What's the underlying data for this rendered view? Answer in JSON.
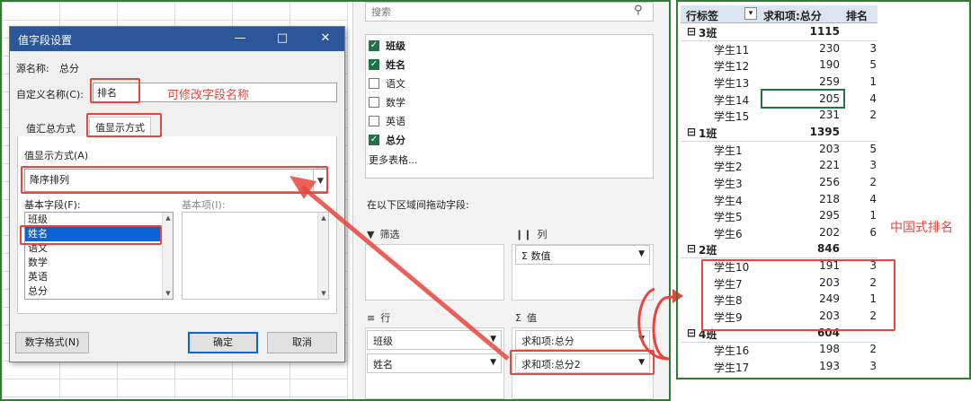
{
  "dialog": {
    "title": "值字段设置",
    "source_label": "源名称:",
    "source_value": "总分",
    "custom_label": "自定义名称(C):",
    "custom_value": "排名",
    "tabs": [
      "值汇总方式",
      "值显示方式"
    ],
    "display_label": "值显示方式(A)",
    "display_value": "降序排列",
    "base_field_label": "基本字段(F):",
    "base_item_label": "基本项(I):",
    "base_fields": [
      "班级",
      "姓名",
      "语文",
      "数学",
      "英语",
      "总分"
    ],
    "number_format_btn": "数字格式(N)",
    "ok_btn": "确定",
    "cancel_btn": "取消"
  },
  "annotations": {
    "edit_name": "可修改字段名称",
    "chinese_rank": "中国式排名"
  },
  "pane": {
    "search_placeholder": "搜索",
    "fields": [
      {
        "name": "班级",
        "checked": true
      },
      {
        "name": "姓名",
        "checked": true
      },
      {
        "name": "语文",
        "checked": false
      },
      {
        "name": "数学",
        "checked": false
      },
      {
        "name": "英语",
        "checked": false
      },
      {
        "name": "总分",
        "checked": true
      }
    ],
    "more_tables": "更多表格...",
    "drag_hint": "在以下区域间拖动字段:",
    "filter_label": "筛选",
    "columns_label": "列",
    "columns_chip": "数值",
    "rows_label": "行",
    "values_label": "值",
    "rows_chips": [
      "班级",
      "姓名"
    ],
    "values_chips": [
      "求和项:总分",
      "求和项:总分2"
    ]
  },
  "pivot": {
    "headers": [
      "行标签",
      "求和项:总分",
      "排名"
    ],
    "groups": [
      {
        "name": "3班",
        "total": "1115",
        "rows": [
          [
            "学生11",
            "230",
            "3"
          ],
          [
            "学生12",
            "190",
            "5"
          ],
          [
            "学生13",
            "259",
            "1"
          ],
          [
            "学生14",
            "205",
            "4"
          ],
          [
            "学生15",
            "231",
            "2"
          ]
        ]
      },
      {
        "name": "1班",
        "total": "1395",
        "rows": [
          [
            "学生1",
            "203",
            "5"
          ],
          [
            "学生2",
            "221",
            "3"
          ],
          [
            "学生3",
            "256",
            "2"
          ],
          [
            "学生4",
            "218",
            "4"
          ],
          [
            "学生5",
            "295",
            "1"
          ],
          [
            "学生6",
            "202",
            "6"
          ]
        ]
      },
      {
        "name": "2班",
        "total": "846",
        "rows": [
          [
            "学生10",
            "191",
            "3"
          ],
          [
            "学生7",
            "203",
            "2"
          ],
          [
            "学生8",
            "249",
            "1"
          ],
          [
            "学生9",
            "203",
            "2"
          ]
        ]
      },
      {
        "name": "4班",
        "total": "604",
        "rows": [
          [
            "学生16",
            "198",
            "2"
          ],
          [
            "学生17",
            "193",
            "3"
          ]
        ]
      }
    ]
  },
  "colors": {
    "frame": "#2e7d32",
    "annotation": "#e8453c",
    "dialog_title": "#2b579a",
    "pivot_header": "#dbe5f1"
  }
}
